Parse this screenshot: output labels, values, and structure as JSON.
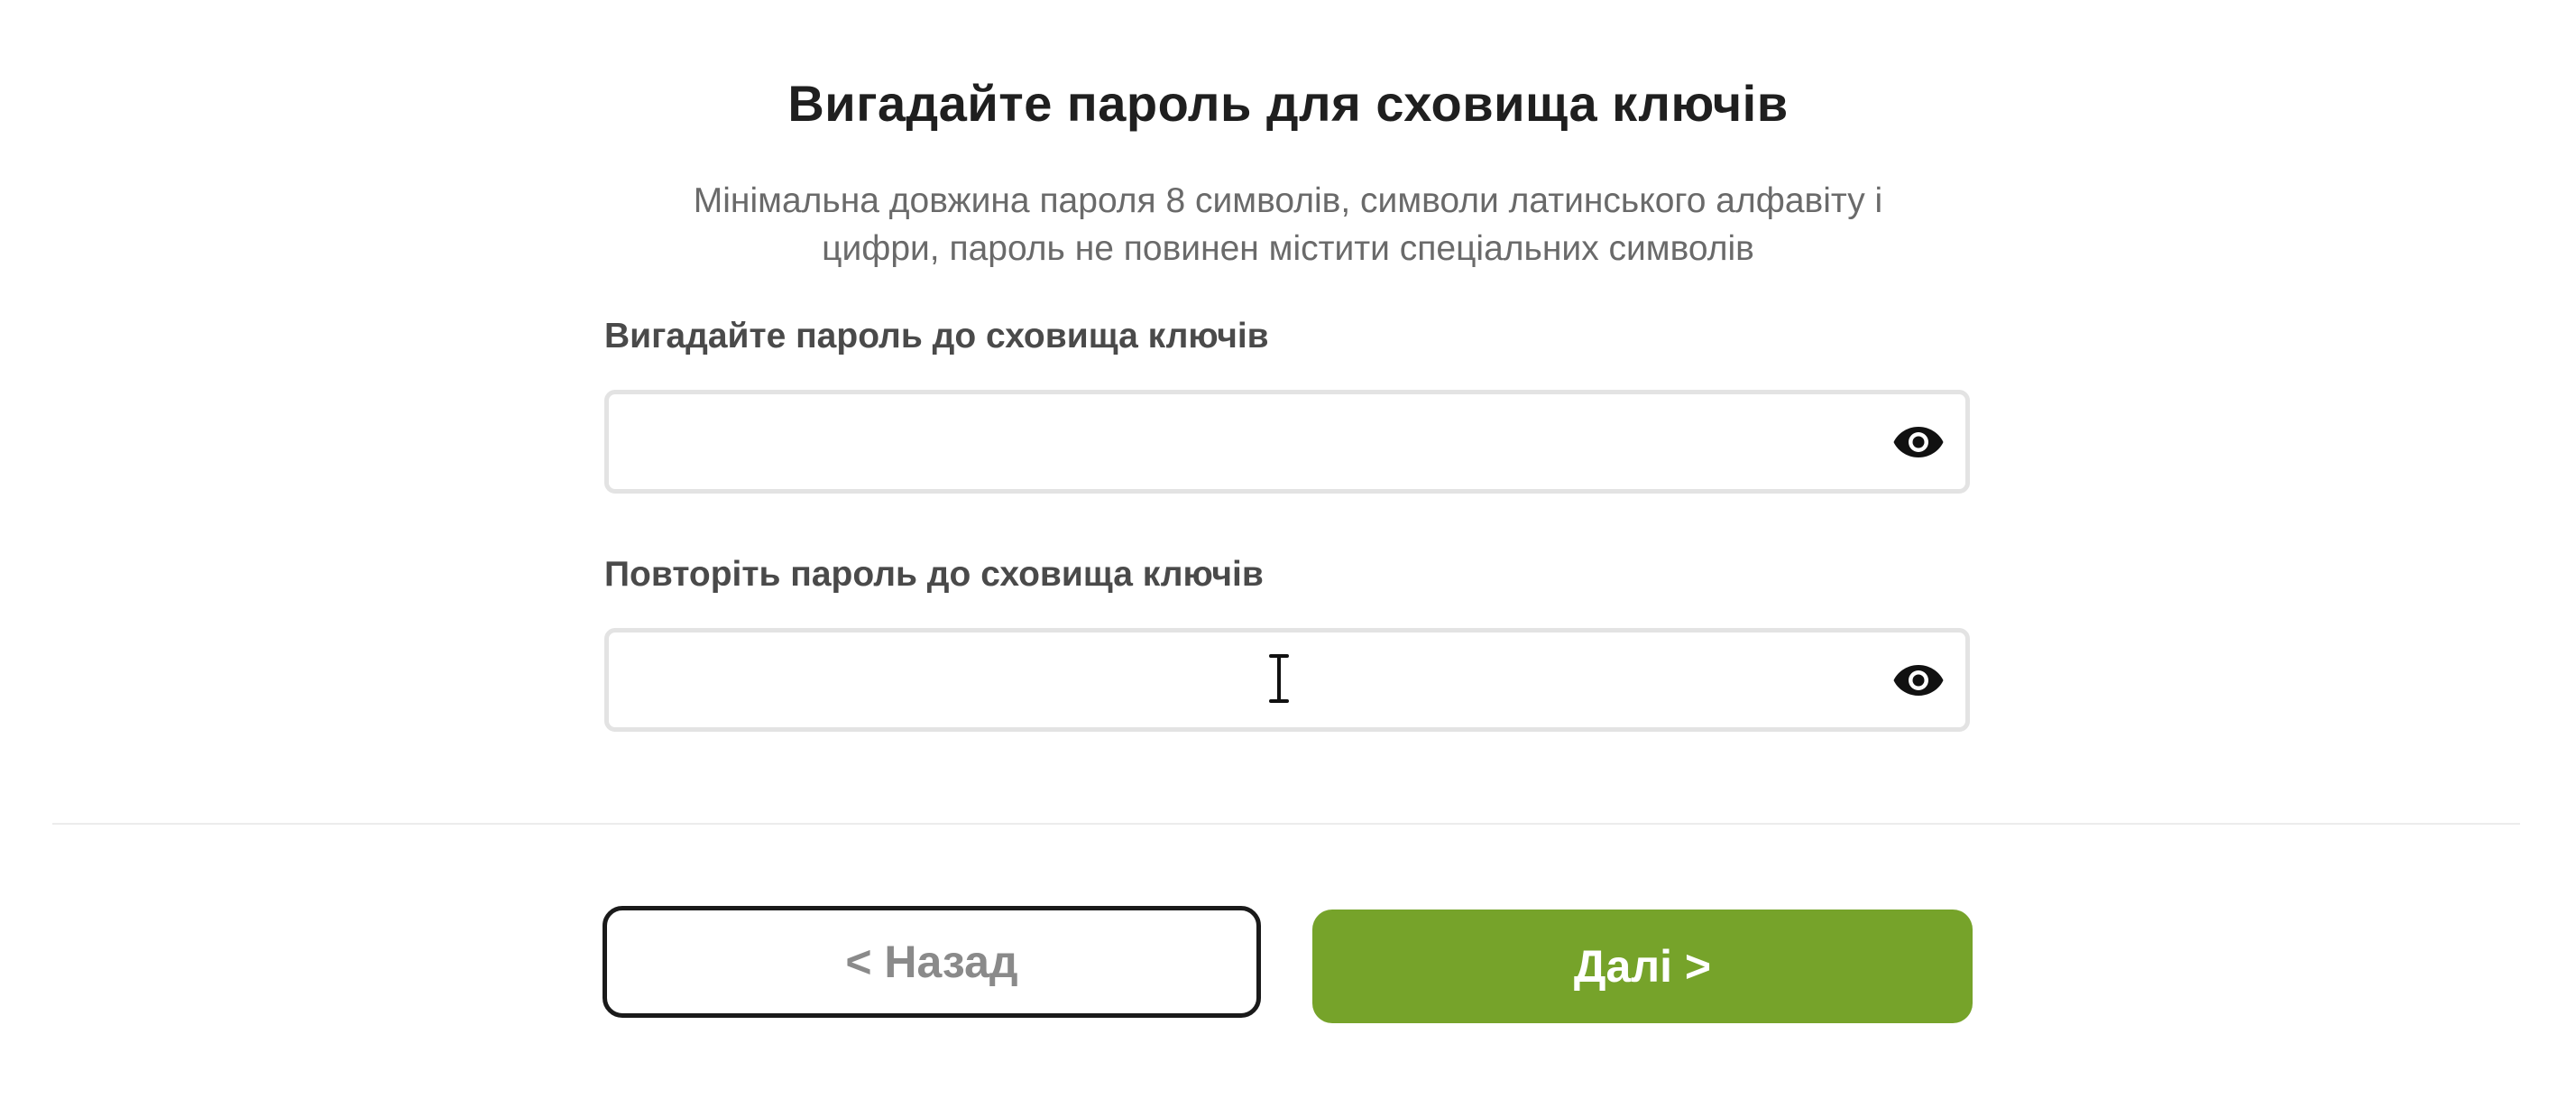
{
  "form": {
    "title": "Вигадайте пароль для сховища ключів",
    "hint_line1": "Мінімальна довжина пароля 8 символів, символи латинського алфавіту і",
    "hint_line2": "цифри, пароль не повинен містити спеціальних символів",
    "password_label": "Вигадайте пароль до сховища ключів",
    "password_value": "",
    "password_toggle_icon": "eye-icon",
    "confirm_label": "Повторіть пароль до сховища ключів",
    "confirm_value": "",
    "confirm_toggle_icon": "eye-icon"
  },
  "footer": {
    "back_label": "< Назад",
    "next_label": "Далі >"
  },
  "colors": {
    "accent": "#76a32a",
    "border": "#e3e3e3",
    "text": "#1f1f1f",
    "muted": "#6a6a6a"
  }
}
